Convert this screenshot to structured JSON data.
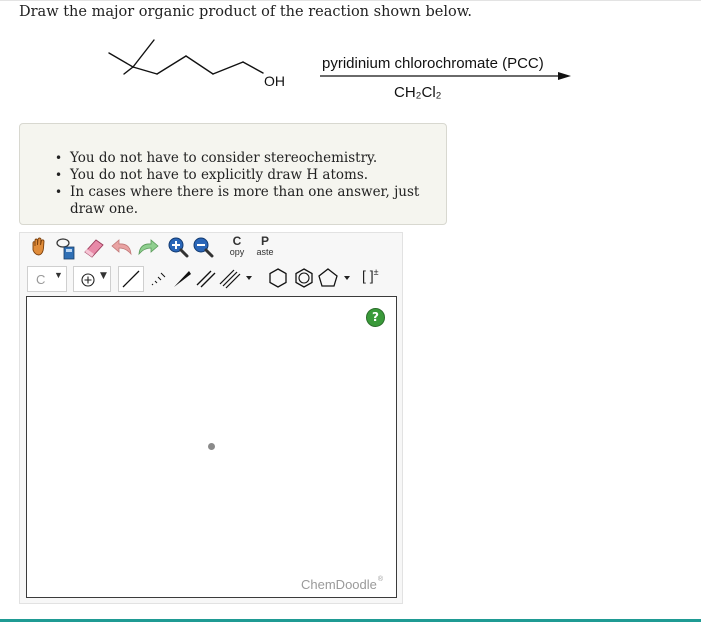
{
  "question": {
    "prompt": "Draw the major organic product of the reaction shown below."
  },
  "reaction": {
    "substituent_label": "OH",
    "reagent": "pyridinium chlorochromate (PCC)",
    "solvent": "CH₂Cl₂"
  },
  "notes": [
    "You do not have to consider stereochemistry.",
    "You do not have to explicitly draw H atoms.",
    "In cases where there is more than one answer, just draw one."
  ],
  "editor": {
    "copy_big": "C",
    "copy_small": "opy",
    "paste_big": "P",
    "paste_small": "aste",
    "atom_label": "C",
    "help_label": "?",
    "bracket_label": "[ ]",
    "bracket_sup": "±",
    "brand": "ChemDoodle",
    "brand_mark": "®",
    "icons": [
      "hand-icon",
      "lasso-icon",
      "eraser-icon",
      "undo-icon",
      "redo-icon",
      "zoom-in-icon",
      "zoom-out-icon",
      "charge-plus-icon",
      "single-bond-icon",
      "hashed-bond-icon",
      "wedge-bond-icon",
      "double-bond-icon",
      "triple-bond-icon",
      "cyclohexane-icon",
      "benzene-icon",
      "cyclopentane-icon"
    ]
  },
  "colors": {
    "notes_bg": "#f5f5ef",
    "accent": "#1f9b94",
    "help_green": "#3a9a3a"
  }
}
